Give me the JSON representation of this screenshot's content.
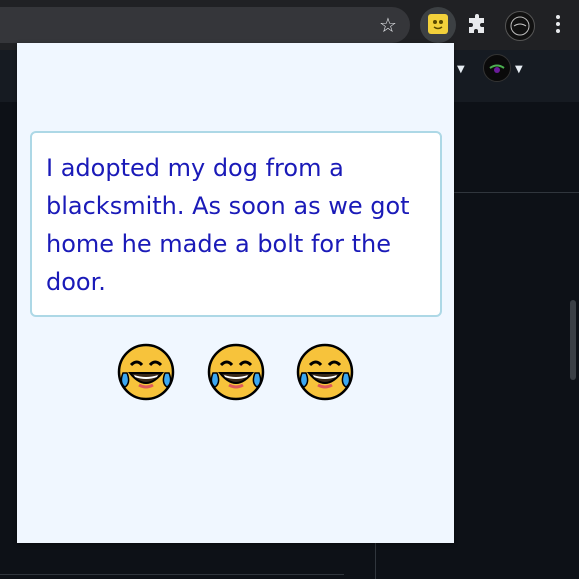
{
  "browser": {
    "toolbar_icons": [
      "star-icon",
      "joke-extension-icon",
      "puzzle-icon",
      "profile-avatar",
      "menu-icon"
    ]
  },
  "popup": {
    "joke_text": "I adopted my dog from a blacksmith. As soon as we got home he made a bolt for the door.",
    "emoji": [
      "laughing-tears-icon",
      "laughing-tears-icon",
      "laughing-tears-icon"
    ],
    "colors": {
      "background": "#f0f7ff",
      "card_border": "#add8e6",
      "text": "#1a1ab8"
    }
  }
}
